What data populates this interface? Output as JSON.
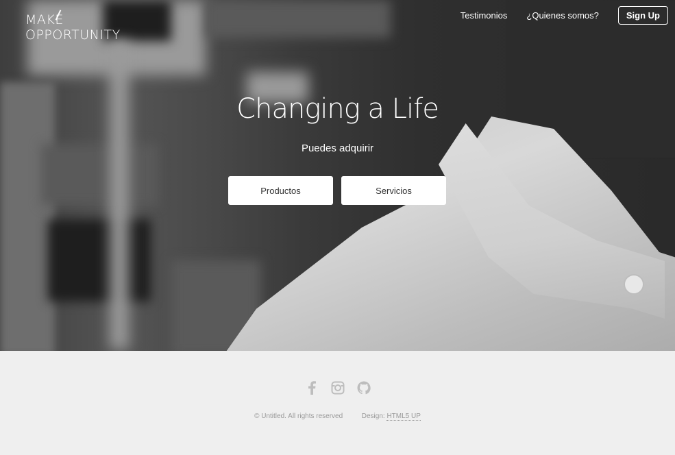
{
  "logo": {
    "line1": "MAKE",
    "line2": "OPPORTUNITY"
  },
  "nav": {
    "links": [
      "Testimonios",
      "¿Quienes somos?"
    ],
    "signup": "Sign Up"
  },
  "hero": {
    "title": "Changing a Life",
    "subtitle": "Puedes adquirir",
    "buttons": [
      "Productos",
      "Servicios"
    ]
  },
  "footer": {
    "icons": [
      "facebook-icon",
      "instagram-icon",
      "github-icon"
    ],
    "copyright": "© Untitled. All rights reserved",
    "design_label": "Design:",
    "design_link": "HTML5 UP"
  },
  "colors": {
    "footer_bg": "#efefef",
    "icon_gray": "#bdbdbd",
    "hero_text": "#ffffff"
  }
}
